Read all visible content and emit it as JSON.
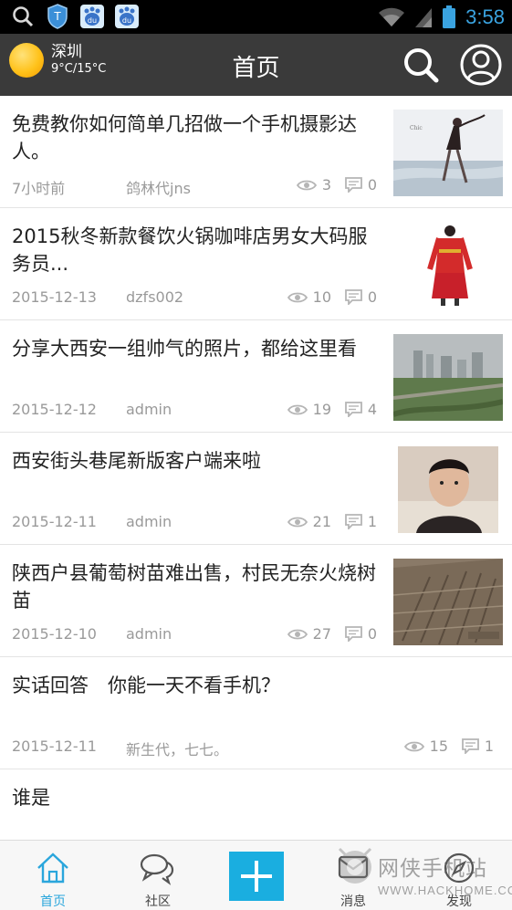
{
  "status_bar": {
    "time": "3:58"
  },
  "header": {
    "city": "深圳",
    "temperature": "9°C/15°C",
    "title": "首页",
    "weather_icon": "sun-icon",
    "search_icon": "search-icon",
    "profile_icon": "user-icon"
  },
  "feed": {
    "items": [
      {
        "title": "免费教你如何简单几招做一个手机摄影达人。",
        "date": "7小时前",
        "author": "鸽林代jns",
        "views": "3",
        "comments": "0"
      },
      {
        "title": "2015秋冬新款餐饮火锅咖啡店男女大码服务员...",
        "date": "2015-12-13",
        "author": "dzfs002",
        "views": "10",
        "comments": "0"
      },
      {
        "title": "分享大西安一组帅气的照片，都给这里看",
        "date": "2015-12-12",
        "author": "admin",
        "views": "19",
        "comments": "4"
      },
      {
        "title": "西安街头巷尾新版客户端来啦",
        "date": "2015-12-11",
        "author": "admin",
        "views": "21",
        "comments": "1"
      },
      {
        "title": "陕西户县葡萄树苗难出售，村民无奈火烧树苗",
        "date": "2015-12-10",
        "author": "admin",
        "views": "27",
        "comments": "0"
      },
      {
        "title": "实话回答　你能一天不看手机？",
        "date": "2015-12-11",
        "author": "新生代，七七。",
        "views": "15",
        "comments": "1"
      },
      {
        "title": "谁是"
      }
    ]
  },
  "tabbar": {
    "tabs": [
      {
        "label": "首页",
        "active": true
      },
      {
        "label": "社区",
        "active": false
      },
      {
        "label": "消息",
        "active": false
      },
      {
        "label": "发现",
        "active": false
      }
    ],
    "accent_color": "#1aaee0"
  },
  "watermark": {
    "text": "网侠手机站",
    "sub": "WWW.HACKHOME.COM"
  }
}
